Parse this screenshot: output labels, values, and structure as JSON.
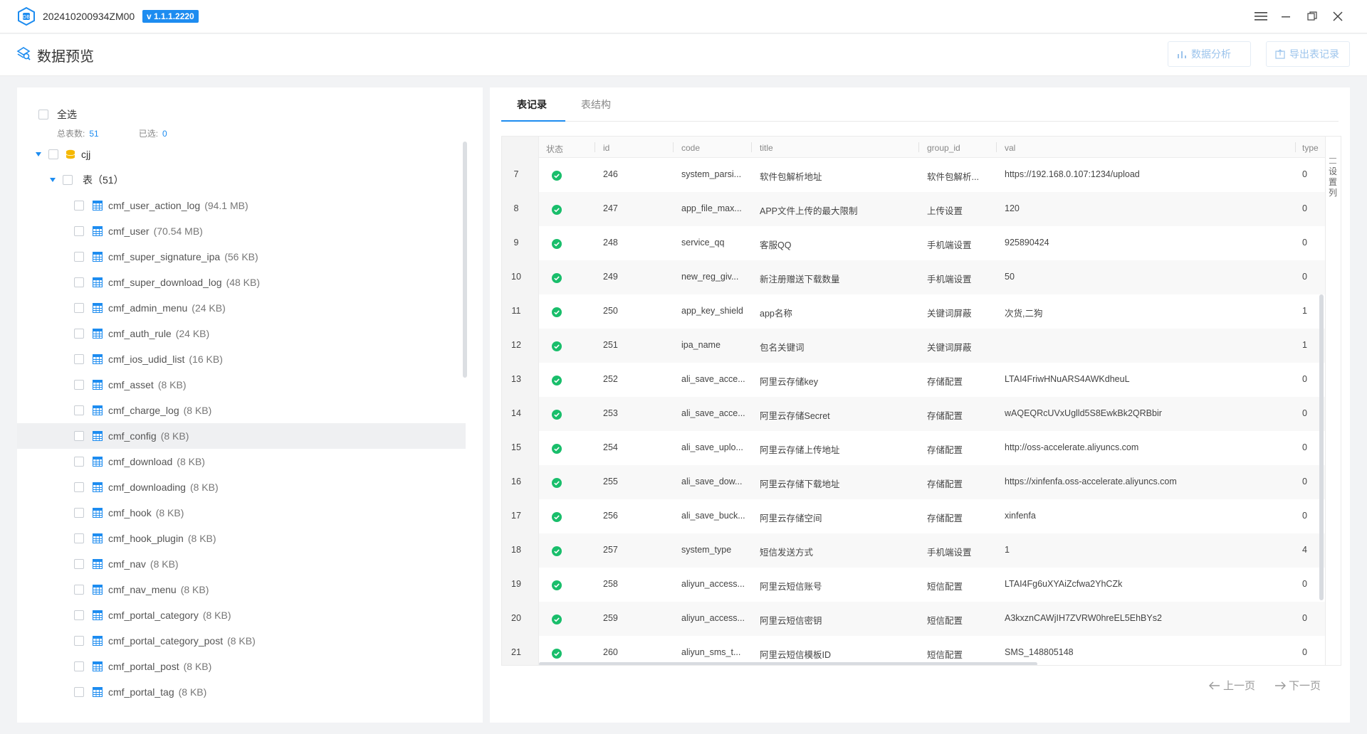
{
  "window": {
    "title": "202410200934ZM00",
    "version": "v 1.1.1.2220"
  },
  "header": {
    "title": "数据预览",
    "analyze_label": "数据分析",
    "export_label": "导出表记录"
  },
  "sidebar": {
    "select_all": "全选",
    "total_label": "总表数:",
    "total_count": "51",
    "selected_label": "已选:",
    "selected_count": "0",
    "db_name": "cjj",
    "group_label": "表（51）",
    "tables": [
      {
        "name": "cmf_user_action_log",
        "size": "(94.1 MB)"
      },
      {
        "name": "cmf_user",
        "size": "(70.54 MB)"
      },
      {
        "name": "cmf_super_signature_ipa",
        "size": "(56 KB)"
      },
      {
        "name": "cmf_super_download_log",
        "size": "(48 KB)"
      },
      {
        "name": "cmf_admin_menu",
        "size": "(24 KB)"
      },
      {
        "name": "cmf_auth_rule",
        "size": "(24 KB)"
      },
      {
        "name": "cmf_ios_udid_list",
        "size": "(16 KB)"
      },
      {
        "name": "cmf_asset",
        "size": "(8 KB)"
      },
      {
        "name": "cmf_charge_log",
        "size": "(8 KB)"
      },
      {
        "name": "cmf_config",
        "size": "(8 KB)"
      },
      {
        "name": "cmf_download",
        "size": "(8 KB)"
      },
      {
        "name": "cmf_downloading",
        "size": "(8 KB)"
      },
      {
        "name": "cmf_hook",
        "size": "(8 KB)"
      },
      {
        "name": "cmf_hook_plugin",
        "size": "(8 KB)"
      },
      {
        "name": "cmf_nav",
        "size": "(8 KB)"
      },
      {
        "name": "cmf_nav_menu",
        "size": "(8 KB)"
      },
      {
        "name": "cmf_portal_category",
        "size": "(8 KB)"
      },
      {
        "name": "cmf_portal_category_post",
        "size": "(8 KB)"
      },
      {
        "name": "cmf_portal_post",
        "size": "(8 KB)"
      },
      {
        "name": "cmf_portal_tag",
        "size": "(8 KB)"
      }
    ]
  },
  "tabs": {
    "records": "表记录",
    "structure": "表结构"
  },
  "grid": {
    "columns": {
      "status": "状态",
      "id": "id",
      "code": "code",
      "title": "title",
      "group_id": "group_id",
      "val": "val",
      "type": "type"
    },
    "settings_label": "设置列",
    "rows": [
      {
        "idx": "7",
        "id": "246",
        "code": "system_parsi...",
        "title": "软件包解析地址",
        "group_id": "软件包解析...",
        "val": "https://192.168.0.107:1234/upload",
        "type": "0"
      },
      {
        "idx": "8",
        "id": "247",
        "code": "app_file_max...",
        "title": "APP文件上传的最大限制",
        "group_id": "上传设置",
        "val": "120",
        "type": "0"
      },
      {
        "idx": "9",
        "id": "248",
        "code": "service_qq",
        "title": "客服QQ",
        "group_id": "手机端设置",
        "val": "925890424",
        "type": "0"
      },
      {
        "idx": "10",
        "id": "249",
        "code": "new_reg_giv...",
        "title": "新注册赠送下载数量",
        "group_id": "手机端设置",
        "val": "50",
        "type": "0"
      },
      {
        "idx": "11",
        "id": "250",
        "code": "app_key_shield",
        "title": "app名称",
        "group_id": "关键词屏蔽",
        "val": "次货,二狗",
        "type": "1"
      },
      {
        "idx": "12",
        "id": "251",
        "code": "ipa_name",
        "title": "包名关键词",
        "group_id": "关键词屏蔽",
        "val": "",
        "type": "1"
      },
      {
        "idx": "13",
        "id": "252",
        "code": "ali_save_acce...",
        "title": "阿里云存储key",
        "group_id": "存储配置",
        "val": "LTAI4FriwHNuARS4AWKdheuL",
        "type": "0"
      },
      {
        "idx": "14",
        "id": "253",
        "code": "ali_save_acce...",
        "title": "阿里云存储Secret",
        "group_id": "存储配置",
        "val": "wAQEQRcUVxUglld5S8EwkBk2QRBbir",
        "type": "0"
      },
      {
        "idx": "15",
        "id": "254",
        "code": "ali_save_uplo...",
        "title": "阿里云存储上传地址",
        "group_id": "存储配置",
        "val": "http://oss-accelerate.aliyuncs.com",
        "type": "0"
      },
      {
        "idx": "16",
        "id": "255",
        "code": "ali_save_dow...",
        "title": "阿里云存储下载地址",
        "group_id": "存储配置",
        "val": "https://xinfenfa.oss-accelerate.aliyuncs.com",
        "type": "0"
      },
      {
        "idx": "17",
        "id": "256",
        "code": "ali_save_buck...",
        "title": "阿里云存储空间",
        "group_id": "存储配置",
        "val": "xinfenfa",
        "type": "0"
      },
      {
        "idx": "18",
        "id": "257",
        "code": "system_type",
        "title": "短信发送方式",
        "group_id": "手机端设置",
        "val": "1",
        "type": "4"
      },
      {
        "idx": "19",
        "id": "258",
        "code": "aliyun_access...",
        "title": "阿里云短信账号",
        "group_id": "短信配置",
        "val": "LTAI4Fg6uXYAiZcfwa2YhCZk",
        "type": "0"
      },
      {
        "idx": "20",
        "id": "259",
        "code": "aliyun_access...",
        "title": "阿里云短信密钥",
        "group_id": "短信配置",
        "val": "A3kxznCAWjIH7ZVRW0hreEL5EhBYs2",
        "type": "0"
      },
      {
        "idx": "21",
        "id": "260",
        "code": "aliyun_sms_t...",
        "title": "阿里云短信模板ID",
        "group_id": "短信配置",
        "val": "SMS_148805148",
        "type": "0"
      }
    ]
  },
  "pager": {
    "prev": "上一页",
    "next": "下一页"
  },
  "colors": {
    "accent": "#1d8cf0",
    "success": "#19be6b"
  }
}
